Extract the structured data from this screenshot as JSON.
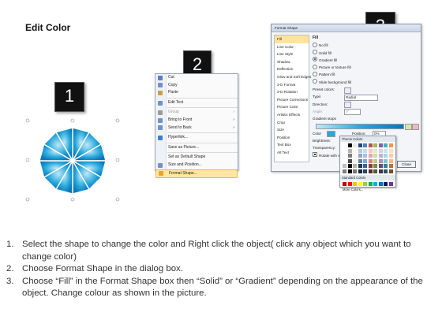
{
  "title": "Edit Color",
  "badges": {
    "one": "1",
    "two": "2",
    "three": "3"
  },
  "context_menu": {
    "items": [
      {
        "label": "Cut",
        "color": "#5b7fbf"
      },
      {
        "label": "Copy",
        "color": "#6f93c7"
      },
      {
        "label": "Paste",
        "color": "#c7a14a"
      },
      {
        "label": "Edit Text",
        "color": "#6f93c7"
      },
      {
        "label": "Group",
        "color": "#9a9a9a"
      },
      {
        "label": "Bring to Front",
        "color": "#6f93c7"
      },
      {
        "label": "Send to Back",
        "color": "#6f93c7"
      },
      {
        "label": "Hyperlink...",
        "color": "#3d7fcf"
      },
      {
        "label": "Save as Picture...",
        "color": "#fafafa"
      },
      {
        "label": "Set as Default Shape",
        "color": "#fafafa"
      },
      {
        "label": "Size and Position...",
        "color": "#6f93c7"
      },
      {
        "label": "Format Shape...",
        "color": "#e3a53a"
      }
    ]
  },
  "dialog": {
    "title": "Format Shape",
    "categories": [
      "Fill",
      "Line Color",
      "Line Style",
      "Shadow",
      "Reflection",
      "Glow and Soft Edges",
      "3-D Format",
      "3-D Rotation",
      "Picture Corrections",
      "Picture Color",
      "Artistic Effects",
      "Crop",
      "Size",
      "Position",
      "Text Box",
      "Alt Text"
    ],
    "fill_heading": "Fill",
    "fill_options": [
      "No fill",
      "Solid fill",
      "Gradient fill",
      "Picture or texture fill",
      "Pattern fill",
      "Slide background fill"
    ],
    "preset_label": "Preset colors:",
    "type_label": "Type:",
    "type_value": "Radial",
    "direction_label": "Direction:",
    "angle_label": "Angle:",
    "angle_value": "0°",
    "stops_label": "Gradient stops",
    "color_label": "Color",
    "position_label": "Position:",
    "position_value": "0%",
    "brightness_label": "Brightness:",
    "transparency_label": "Transparency:",
    "rotate_label": "Rotate with shape",
    "close_label": "Close"
  },
  "palette": {
    "theme_label": "Theme Colors",
    "standard_label": "Standard Colors",
    "more_label": "More Colors...",
    "theme_row": [
      "#ffffff",
      "#000000",
      "#eeece1",
      "#1f497d",
      "#4f81bd",
      "#c0504d",
      "#9bbb59",
      "#8064a2",
      "#4bacc6",
      "#f79646"
    ],
    "standard_row": [
      "#c00000",
      "#ff0000",
      "#ffc000",
      "#ffff00",
      "#92d050",
      "#00b050",
      "#00b0f0",
      "#0070c0",
      "#002060",
      "#7030a0"
    ]
  },
  "instructions": [
    {
      "num": "1.",
      "text": "Select the shape to change the color and Right click the object( click any object which you want to change color)"
    },
    {
      "num": "2.",
      "text": "Choose Format Shape in the dialog box."
    },
    {
      "num": "3.",
      "text": "Choose “Fill” in the Format Shape box then “Solid” or “Gradient” depending on the appearance of the object. Change colour as shown in the picture."
    }
  ]
}
